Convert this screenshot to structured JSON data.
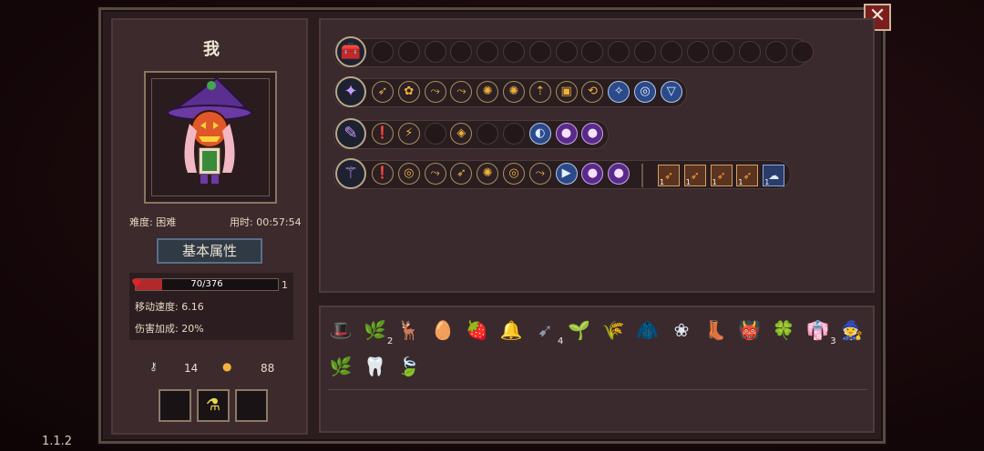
{
  "player": {
    "name": "我",
    "difficulty": "难度: 困难",
    "time": "用时: 00:57:54",
    "section_label": "基本属性",
    "hp": "70/376",
    "hp_fraction": 0.186,
    "hp_extra": "1",
    "move_speed": "移动速度: 6.16",
    "damage_bonus": "伤害加成: 20%",
    "keys": "14",
    "coins": "88"
  },
  "version": "1.1.2",
  "close_label": "✕",
  "weapon_rows": [
    {
      "icon": "treasure-chest-icon",
      "glyph": "🧰",
      "slots": []
    },
    {
      "icon": "magic-staff-icon",
      "glyph": "✦",
      "slots": [
        "➶",
        "✿",
        "⤳",
        "⤳",
        "✺",
        "✺",
        "⇡",
        "▣",
        "⟲",
        "✧",
        "◎",
        "▽"
      ]
    },
    {
      "icon": "crystal-wand-icon",
      "glyph": "✎",
      "slots": [
        "❗",
        "⚡",
        "",
        "◈",
        "",
        "",
        "◐",
        "●",
        "●"
      ]
    },
    {
      "icon": "rod-staff-icon",
      "glyph": "⚚",
      "slots": [
        "❗",
        "◎",
        "⤳",
        "➶",
        "✺",
        "◎",
        "⤳",
        "▶",
        "●",
        "●"
      ]
    }
  ],
  "staff_extra_cards": [
    "1",
    "1",
    "1",
    "1",
    "1"
  ],
  "items": [
    {
      "name": "hat-item-icon",
      "glyph": "🎩",
      "count": ""
    },
    {
      "name": "branch-item-icon",
      "glyph": "🌿",
      "count": "2"
    },
    {
      "name": "antler-item-icon",
      "glyph": "🦌",
      "count": ""
    },
    {
      "name": "egg-item-icon",
      "glyph": "🥚",
      "count": ""
    },
    {
      "name": "potion-item-icon",
      "glyph": "🍓",
      "count": ""
    },
    {
      "name": "bell-item-icon",
      "glyph": "🔔",
      "count": ""
    },
    {
      "name": "arrow-item-icon",
      "glyph": "➹",
      "count": "4"
    },
    {
      "name": "leaf-item-icon",
      "glyph": "🌱",
      "count": ""
    },
    {
      "name": "sprout-item-icon",
      "glyph": "🌾",
      "count": ""
    },
    {
      "name": "cloak-item-icon",
      "glyph": "🧥",
      "count": ""
    },
    {
      "name": "flower-item-icon",
      "glyph": "❀",
      "count": ""
    },
    {
      "name": "boot-item-icon",
      "glyph": "👢",
      "count": ""
    },
    {
      "name": "demon-item-icon",
      "glyph": "👹",
      "count": ""
    },
    {
      "name": "clover-item-icon",
      "glyph": "🍀",
      "count": ""
    },
    {
      "name": "robe-item-icon",
      "glyph": "👘",
      "count": "3"
    },
    {
      "name": "witch-hat-item-icon",
      "glyph": "🧙",
      "count": ""
    },
    {
      "name": "grass-item-icon",
      "glyph": "🌿",
      "count": ""
    },
    {
      "name": "teeth-item-icon",
      "glyph": "🦷",
      "count": ""
    },
    {
      "name": "vine-item-icon",
      "glyph": "🍃",
      "count": ""
    }
  ],
  "colors": {
    "hp": "#b3282a",
    "accent": "#56708a"
  }
}
